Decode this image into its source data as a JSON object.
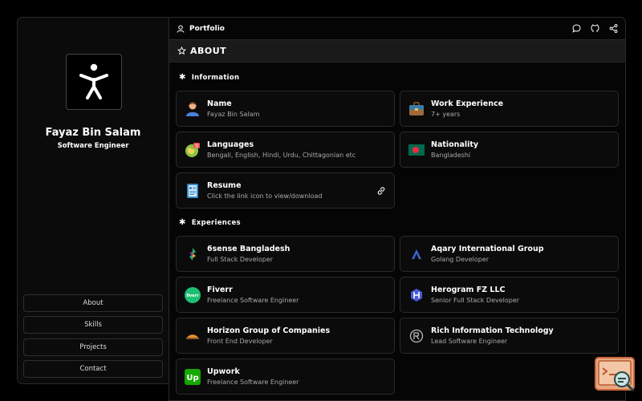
{
  "profile": {
    "name": "Fayaz Bin Salam",
    "role": "Software Engineer"
  },
  "nav": [
    {
      "label": "About"
    },
    {
      "label": "Skills"
    },
    {
      "label": "Projects"
    },
    {
      "label": "Contact"
    }
  ],
  "topbar": {
    "title": "Portfolio",
    "icons": [
      "chat-icon",
      "github-icon",
      "share-icon"
    ]
  },
  "section": {
    "title": "ABOUT"
  },
  "information": {
    "heading": "Information",
    "items": [
      {
        "title": "Name",
        "value": "Fayaz Bin Salam",
        "icon": "person-icon"
      },
      {
        "title": "Work Experience",
        "value": "7+ years",
        "icon": "briefcase-icon"
      },
      {
        "title": "Languages",
        "value": "Bengali, English, Hindi, Urdu, Chittagonian etc",
        "icon": "languages-icon"
      },
      {
        "title": "Nationality",
        "value": "Bangladeshi",
        "icon": "bangladesh-flag-icon"
      },
      {
        "title": "Resume",
        "value": "Click the link icon to view/download",
        "icon": "resume-icon"
      }
    ]
  },
  "experiences": {
    "heading": "Experiences",
    "items": [
      {
        "company": "6sense Bangladesh",
        "role": "Full Stack Developer",
        "icon": "6sense-logo-icon"
      },
      {
        "company": "Aqary International Group",
        "role": "Golang Developer",
        "icon": "aqary-logo-icon"
      },
      {
        "company": "Fiverr",
        "role": "Freelance Software Engineer",
        "icon": "fiverr-logo-icon",
        "logo_text": "fiverr"
      },
      {
        "company": "Herogram FZ LLC",
        "role": "Senior Full Stack Developer",
        "icon": "herogram-logo-icon"
      },
      {
        "company": "Horizon Group of Companies",
        "role": "Front End Developer",
        "icon": "horizon-logo-icon"
      },
      {
        "company": "Rich Information Technology",
        "role": "Lead Software Engineer",
        "icon": "rich-it-logo-icon"
      },
      {
        "company": "Upwork",
        "role": "Freelance Software Engineer",
        "icon": "upwork-logo-icon",
        "logo_text": "Up"
      }
    ]
  },
  "colors": {
    "fiverr": "#1dbf73",
    "upwork": "#14a800",
    "flag_green": "#006a4e",
    "flag_red": "#f42a41",
    "floating_widget": "#e8a882"
  }
}
